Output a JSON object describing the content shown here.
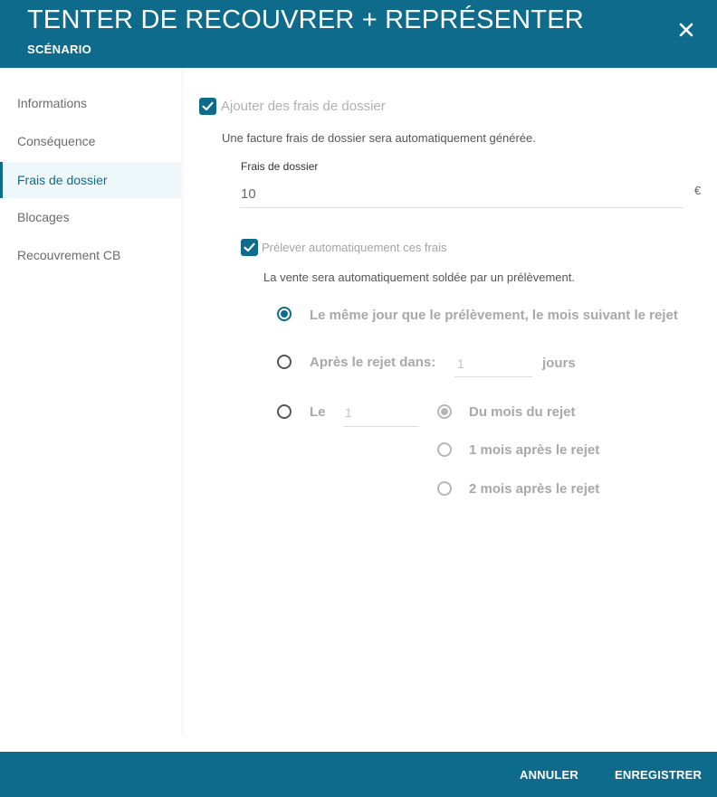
{
  "header": {
    "title": "TENTER DE RECOUVRER + REPRÉSENTER",
    "subtitle": "SCÉNARIO",
    "close_icon": "close-icon"
  },
  "sidebar": {
    "items": [
      {
        "label": "Informations",
        "active": false
      },
      {
        "label": "Conséquence",
        "active": false
      },
      {
        "label": "Frais de dossier",
        "active": true
      },
      {
        "label": "Blocages",
        "active": false
      },
      {
        "label": "Recouvrement CB",
        "active": false
      }
    ]
  },
  "frais": {
    "add_fees_label": "Ajouter des frais de dossier",
    "add_fees_checked": true,
    "add_fees_description": "Une facture frais de dossier sera automatiquement générée.",
    "amount_label": "Frais de dossier",
    "amount_value": "10",
    "currency": "€",
    "auto_debit_label": "Prélever automatiquement ces frais",
    "auto_debit_checked": true,
    "auto_debit_description": "La vente sera automatiquement soldée par un prélèvement.",
    "options": {
      "same_day_label": "Le même jour que le prélèvement, le mois suivant le rejet",
      "after_reject_label": "Après le rejet dans:",
      "after_reject_value": "1",
      "after_reject_unit": "jours",
      "on_day_label": "Le",
      "on_day_value": "1",
      "selected": "same_day"
    },
    "month_options": [
      {
        "label": "Du mois du rejet",
        "selected": true
      },
      {
        "label": "1 mois après le rejet",
        "selected": false
      },
      {
        "label": "2 mois après le rejet",
        "selected": false
      }
    ]
  },
  "footer": {
    "cancel_label": "ANNULER",
    "save_label": "ENREGISTRER"
  },
  "colors": {
    "primary": "#0e6b8c",
    "active_nav_bg": "#eef8fa",
    "disabled_text": "#a8a8a8"
  }
}
